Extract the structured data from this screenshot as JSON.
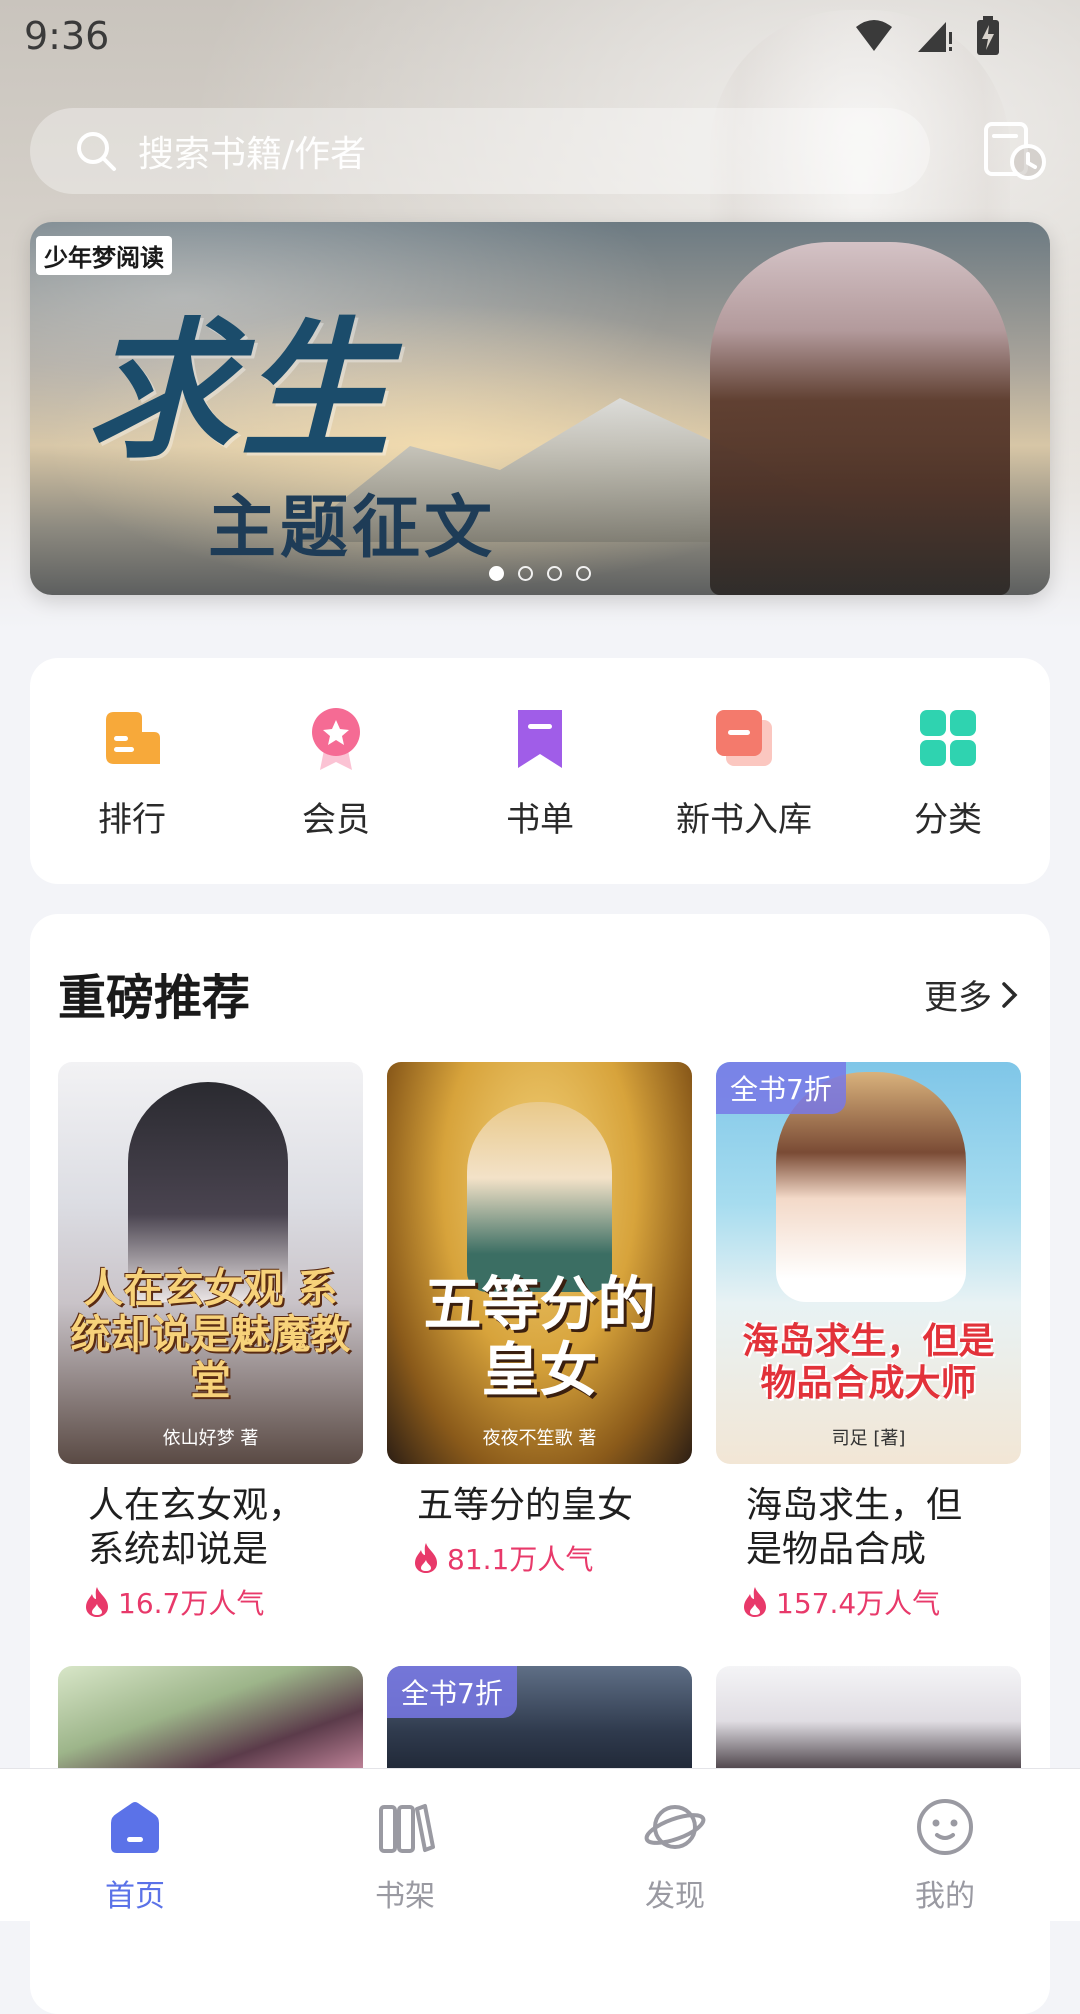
{
  "status_bar": {
    "time": "9:36"
  },
  "search": {
    "placeholder": "搜索书籍/作者"
  },
  "banner": {
    "brand": "少年梦阅读",
    "title": "求生",
    "subtitle": "主题征文",
    "page_count": 4,
    "active_index": 0
  },
  "quick_entries": [
    {
      "label": "排行",
      "icon": "ranking-icon",
      "color": "#f7a93a"
    },
    {
      "label": "会员",
      "icon": "vip-medal-icon",
      "color": "#f56b94"
    },
    {
      "label": "书单",
      "icon": "bookmark-list-icon",
      "color": "#a05de8"
    },
    {
      "label": "新书入库",
      "icon": "new-book-icon",
      "color": "#f47a6c"
    },
    {
      "label": "分类",
      "icon": "category-grid-icon",
      "color": "#2fd3b0"
    }
  ],
  "recommend": {
    "title": "重磅推荐",
    "more_label": "更多",
    "books": [
      {
        "name": "人在玄女观，系统却说是魅...",
        "popularity": "16.7万人气",
        "cover_text": "人在玄女观 系统却说是魅魔教堂",
        "cover_author": "依山好梦 著",
        "discount": ""
      },
      {
        "name": "五等分的皇女",
        "popularity": "81.1万人气",
        "cover_text": "五等分的皇女",
        "cover_author": "夜夜不笙歌 著",
        "discount": ""
      },
      {
        "name": "海岛求生，但是物品合成大...",
        "popularity": "157.4万人气",
        "cover_text": "海岛求生，但是物品合成大师",
        "cover_author": "司足 [著]",
        "discount": "全书7折"
      }
    ],
    "next_row_discount": "全书7折"
  },
  "bottom_nav": [
    {
      "label": "首页",
      "icon": "home-icon",
      "active": true
    },
    {
      "label": "书架",
      "icon": "bookshelf-icon",
      "active": false
    },
    {
      "label": "发现",
      "icon": "discover-planet-icon",
      "active": false
    },
    {
      "label": "我的",
      "icon": "profile-smile-icon",
      "active": false
    }
  ],
  "colors": {
    "accent": "#5b72e8",
    "popularity": "#e8396a",
    "discount_tag": "#7878e6"
  }
}
